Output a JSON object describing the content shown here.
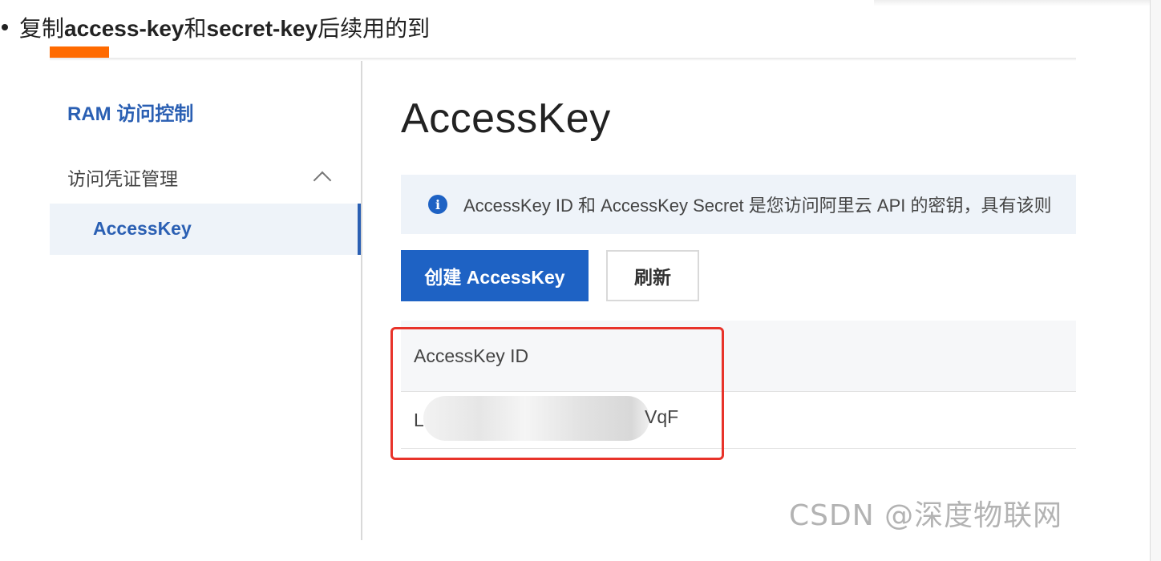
{
  "bullet": {
    "text_before": "复制",
    "bold_1": "access-key",
    "text_middle": "和",
    "bold_2": "secret-key",
    "text_after": "后续用的到"
  },
  "sidebar": {
    "title": "RAM 访问控制",
    "group_label": "访问凭证管理",
    "items": [
      {
        "label": "AccessKey",
        "active": true
      }
    ]
  },
  "main": {
    "title": "AccessKey",
    "notice": "AccessKey ID 和 AccessKey Secret 是您访问阿里云 API 的密钥，具有该则",
    "buttons": {
      "create": "创建 AccessKey",
      "refresh": "刷新"
    },
    "table": {
      "columns": [
        "AccessKey ID"
      ],
      "rows": [
        {
          "id_start": "L",
          "id_end": "VqF"
        }
      ]
    }
  },
  "watermark": "CSDN @深度物联网",
  "colors": {
    "accent": "#1e62c4",
    "brand_orange": "#ff6a00",
    "highlight": "#e8332a",
    "sidebar_title": "#2a5fb3"
  }
}
